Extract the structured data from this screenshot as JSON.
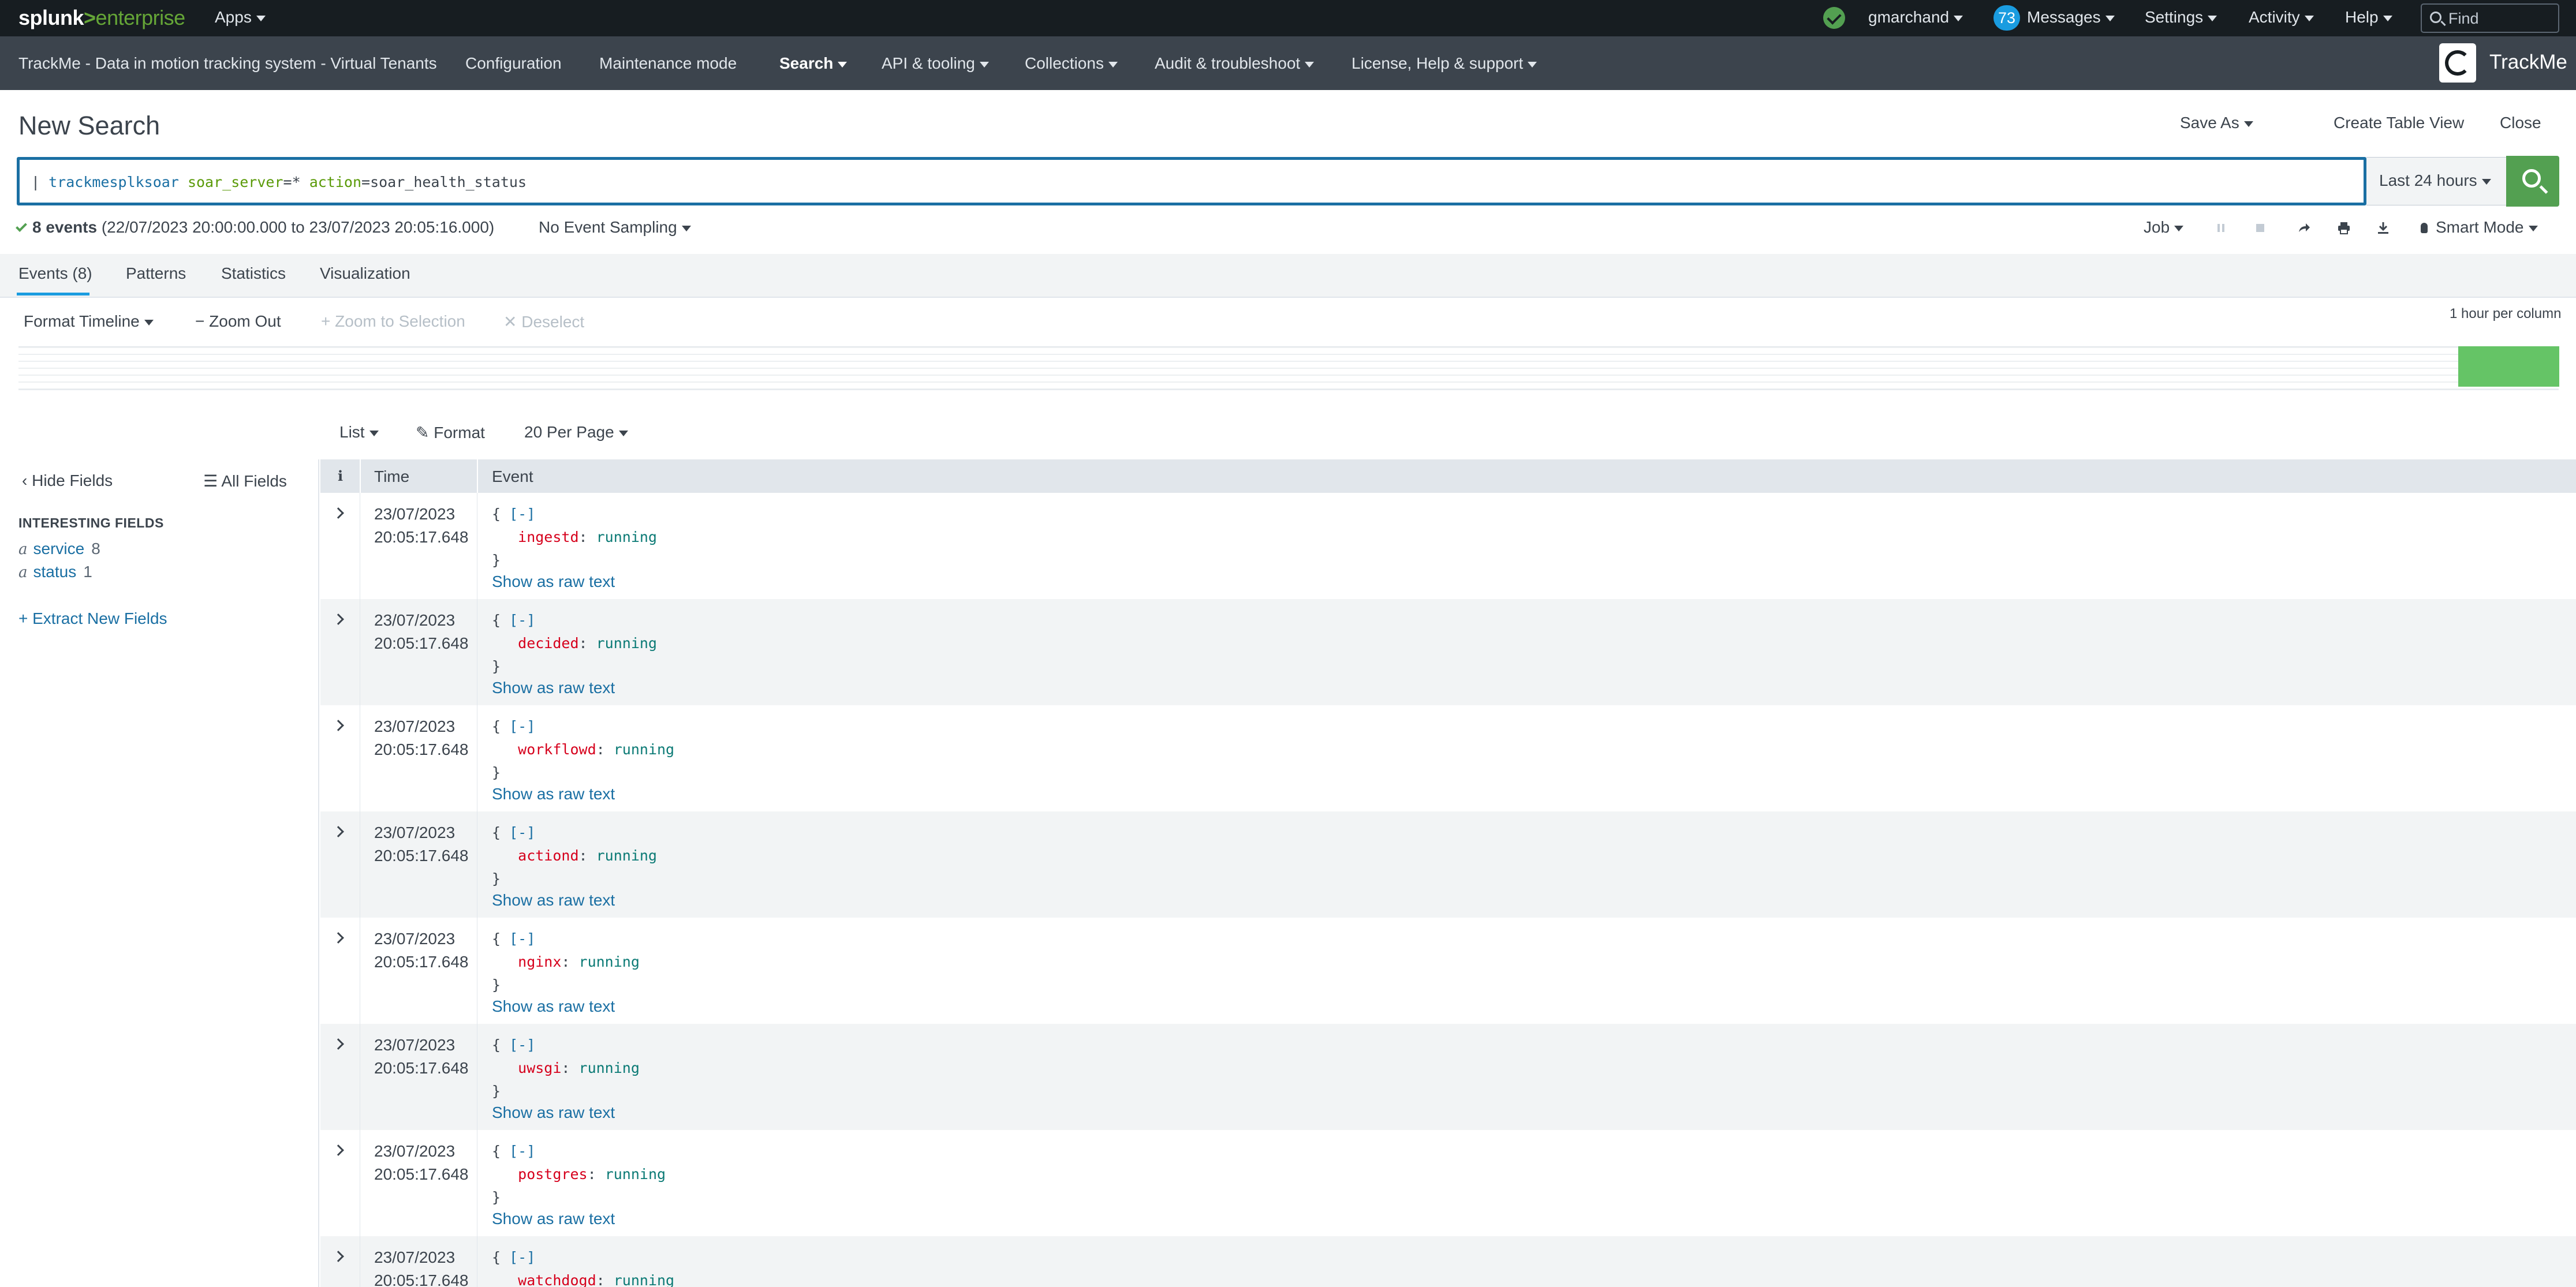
{
  "topbar": {
    "logo_brand": "splunk",
    "logo_gt": ">",
    "logo_product": "enterprise",
    "apps_label": "Apps",
    "user_label": "gmarchand",
    "messages_count": "73",
    "messages_label": "Messages",
    "settings_label": "Settings",
    "activity_label": "Activity",
    "help_label": "Help",
    "find_placeholder": "Find"
  },
  "appbar": {
    "items": [
      "TrackMe - Data in motion tracking system - Virtual Tenants",
      "Configuration",
      "Maintenance mode",
      "Search",
      "API & tooling",
      "Collections",
      "Audit & troubleshoot",
      "License, Help & support"
    ],
    "app_name": "TrackMe"
  },
  "page": {
    "title": "New Search",
    "save_as": "Save As",
    "create_table_view": "Create Table View",
    "close": "Close"
  },
  "search": {
    "query_pipe": "| ",
    "query_cmd": "trackmesplksoar",
    "query_arg1": "soar_server",
    "query_val1": "=*",
    "query_arg2": "action",
    "query_val2": "=soar_health_status",
    "time_range": "Last 24 hours"
  },
  "status": {
    "events_count": "8 events",
    "range": "(22/07/2023 20:00:00.000 to 23/07/2023 20:05:16.000)",
    "sampling": "No Event Sampling",
    "job": "Job",
    "mode": "Smart Mode"
  },
  "tabs": [
    "Events (8)",
    "Patterns",
    "Statistics",
    "Visualization"
  ],
  "timeline": {
    "format": "Format Timeline",
    "zoom_out": "Zoom Out",
    "zoom_selection": "Zoom to Selection",
    "deselect": "Deselect",
    "scale": "1 hour per column"
  },
  "results_toolbar": {
    "list": "List",
    "format": "Format",
    "per_page": "20 Per Page"
  },
  "sidebar": {
    "hide_fields": "Hide Fields",
    "all_fields": "All Fields",
    "interesting_title": "INTERESTING FIELDS",
    "fields": [
      {
        "type": "a",
        "name": "service",
        "count": "8"
      },
      {
        "type": "a",
        "name": "status",
        "count": "1"
      }
    ],
    "extract": "+ Extract New Fields"
  },
  "table": {
    "col_info": "i",
    "col_time": "Time",
    "col_event": "Event",
    "toggle_label": "[-]",
    "raw_link": "Show as raw text",
    "rows": [
      {
        "date": "23/07/2023",
        "time": "20:05:17.648",
        "key": "ingestd",
        "value": "running"
      },
      {
        "date": "23/07/2023",
        "time": "20:05:17.648",
        "key": "decided",
        "value": "running"
      },
      {
        "date": "23/07/2023",
        "time": "20:05:17.648",
        "key": "workflowd",
        "value": "running"
      },
      {
        "date": "23/07/2023",
        "time": "20:05:17.648",
        "key": "actiond",
        "value": "running"
      },
      {
        "date": "23/07/2023",
        "time": "20:05:17.648",
        "key": "nginx",
        "value": "running"
      },
      {
        "date": "23/07/2023",
        "time": "20:05:17.648",
        "key": "uwsgi",
        "value": "running"
      },
      {
        "date": "23/07/2023",
        "time": "20:05:17.648",
        "key": "postgres",
        "value": "running"
      },
      {
        "date": "23/07/2023",
        "time": "20:05:17.648",
        "key": "watchdogd",
        "value": "running"
      }
    ]
  }
}
